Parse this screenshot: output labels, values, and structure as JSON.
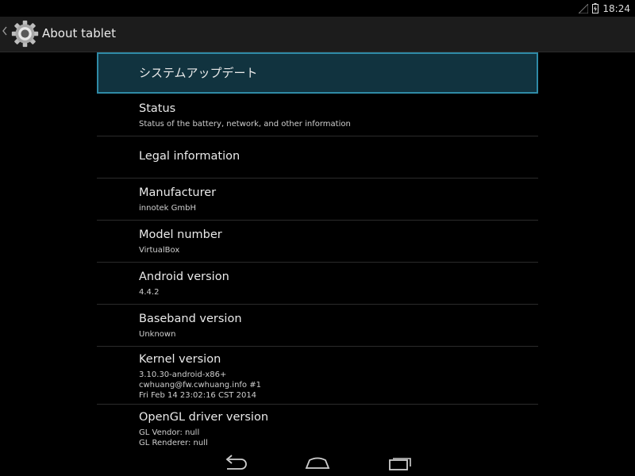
{
  "status_bar": {
    "time": "18:24",
    "icons": [
      "signal-icon",
      "battery-charging-icon"
    ]
  },
  "action_bar": {
    "title": "About tablet",
    "icon": "settings-gear-icon",
    "up_icon": "chevron-left-icon"
  },
  "preferences": [
    {
      "title": "システムアップデート",
      "lines": [],
      "selected": true
    },
    {
      "title": "Status",
      "lines": [
        "Status of the battery, network, and other information"
      ]
    },
    {
      "title": "Legal information",
      "lines": []
    },
    {
      "title": "Manufacturer",
      "lines": [
        "innotek GmbH"
      ]
    },
    {
      "title": "Model number",
      "lines": [
        "VirtualBox"
      ]
    },
    {
      "title": "Android version",
      "lines": [
        "4.4.2"
      ]
    },
    {
      "title": "Baseband version",
      "lines": [
        "Unknown"
      ]
    },
    {
      "title": "Kernel version",
      "lines": [
        "3.10.30-android-x86+",
        "cwhuang@fw.cwhuang.info #1",
        "Fri Feb 14 23:02:16 CST 2014"
      ]
    },
    {
      "title": "OpenGL driver version",
      "lines": [
        "GL Vendor: null",
        "GL Renderer: null"
      ]
    }
  ],
  "nav_bar": {
    "icons": [
      "back-icon",
      "home-icon",
      "recent-apps-icon"
    ]
  },
  "colors": {
    "accent": "#2f8aa6",
    "selected_bg": "#11333f",
    "action_bar_bg": "#1c1c1c",
    "divider": "#2b2b2b"
  }
}
